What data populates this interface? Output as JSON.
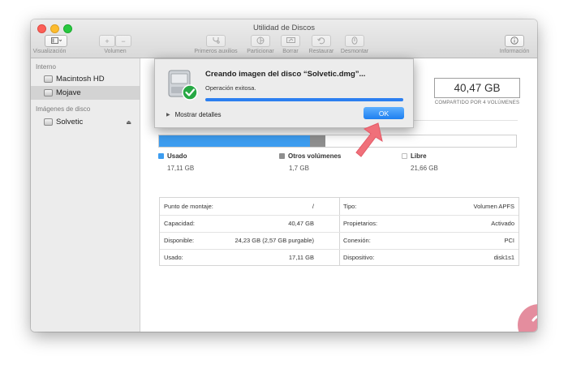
{
  "window": {
    "title": "Utilidad de Discos"
  },
  "toolbar": {
    "view_label": "Visualización",
    "volume_label": "Volumen",
    "first_aid_label": "Primeros auxilios",
    "partition_label": "Particionar",
    "erase_label": "Borrar",
    "restore_label": "Restaurar",
    "unmount_label": "Desmontar",
    "info_label": "Información",
    "add_symbol": "+",
    "remove_symbol": "−"
  },
  "sidebar": {
    "internal_header": "Interno",
    "internal_items": [
      {
        "label": "Macintosh HD",
        "selected": false
      },
      {
        "label": "Mojave",
        "selected": true
      }
    ],
    "images_header": "Imágenes de disco",
    "image_items": [
      {
        "label": "Solvetic",
        "ejectable": true
      }
    ],
    "eject_symbol": "⏏"
  },
  "volume": {
    "capacity": "40,47 GB",
    "capacity_caption": "COMPARTIDO POR 4 VOLÚMENES"
  },
  "usage": {
    "used": {
      "label": "Usado",
      "value": "17,11 GB",
      "color": "#3d9df0",
      "fraction": 0.4228
    },
    "other": {
      "label": "Otros volúmenes",
      "value": "1,7 GB",
      "color": "#8f8f8f",
      "fraction": 0.042
    },
    "free": {
      "label": "Libre",
      "value": "21,66 GB",
      "color": "#ffffff"
    }
  },
  "info": {
    "rows": [
      {
        "key1": "Punto de montaje:",
        "val1": "/",
        "key2": "Tipo:",
        "val2": "Volumen APFS"
      },
      {
        "key1": "Capacidad:",
        "val1": "40,47 GB",
        "key2": "Propietarios:",
        "val2": "Activado"
      },
      {
        "key1": "Disponible:",
        "val1": "24,23 GB (2,57 GB purgable)",
        "key2": "Conexión:",
        "val2": "PCI"
      },
      {
        "key1": "Usado:",
        "val1": "17,11 GB",
        "key2": "Dispositivo:",
        "val2": "disk1s1"
      }
    ]
  },
  "dialog": {
    "title": "Creando imagen del disco “Solvetic.dmg”...",
    "status": "Operación exitosa.",
    "progress_fraction": 1.0,
    "details_label": "Mostrar detalles",
    "ok_label": "OK"
  },
  "colors": {
    "accent": "#2c7ff0",
    "arrow": "#f0707a",
    "success": "#27a844"
  }
}
